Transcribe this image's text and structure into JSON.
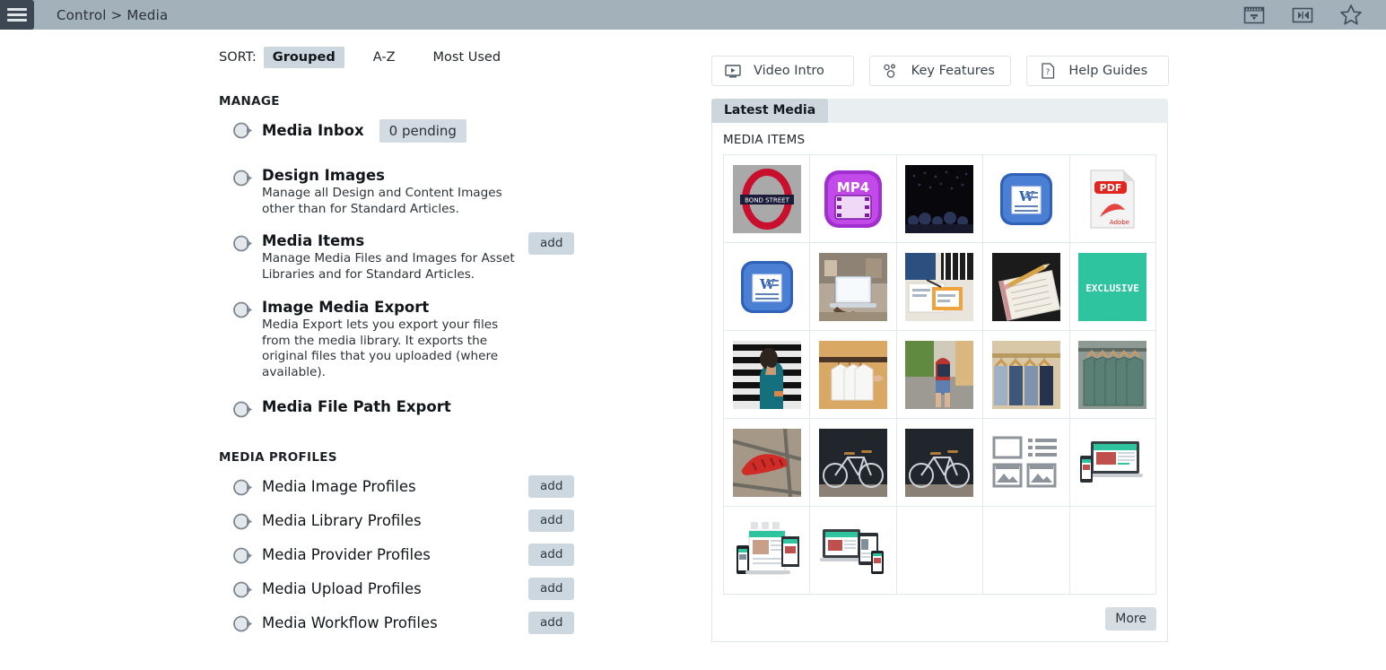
{
  "topbar": {
    "menu_icon": "hamburger-menu-icon",
    "breadcrumb": "Control > Media",
    "icons": [
      {
        "name": "media-panel-icon",
        "label": "panel"
      },
      {
        "name": "navigation-arrows-icon",
        "label": "nav"
      },
      {
        "name": "favourite-star-icon",
        "label": "star"
      }
    ]
  },
  "sort": {
    "label": "SORT:",
    "options": [
      {
        "label": "Grouped",
        "active": true
      },
      {
        "label": "A-Z",
        "active": false
      },
      {
        "label": "Most Used",
        "active": false
      }
    ]
  },
  "manage": {
    "heading": "MANAGE",
    "items": [
      {
        "title": "Media Inbox",
        "desc": "",
        "pill": "0 pending",
        "add": ""
      },
      {
        "title": "Design Images",
        "desc": "Manage all Design and Content Images other than for Standard Articles.",
        "pill": "",
        "add": ""
      },
      {
        "title": "Media Items",
        "desc": "Manage Media Files and Images for Asset Libraries and for Standard Articles.",
        "pill": "",
        "add": "add"
      },
      {
        "title": "Image Media Export",
        "desc": "Media Export lets you export your files from the media library. It exports the original files that you uploaded (where available).",
        "pill": "",
        "add": ""
      },
      {
        "title": "Media File Path Export",
        "desc": "",
        "pill": "",
        "add": ""
      }
    ]
  },
  "profiles": {
    "heading": "MEDIA PROFILES",
    "items": [
      {
        "title": "Media Image Profiles",
        "add": "add"
      },
      {
        "title": "Media Library Profiles",
        "add": "add"
      },
      {
        "title": "Media Provider Profiles",
        "add": "add"
      },
      {
        "title": "Media Upload Profiles",
        "add": "add"
      },
      {
        "title": "Media Workflow Profiles",
        "add": "add"
      }
    ]
  },
  "actions": [
    {
      "label": "Video Intro",
      "icon": "video-play-icon"
    },
    {
      "label": "Key Features",
      "icon": "key-features-icon"
    },
    {
      "label": "Help Guides",
      "icon": "help-document-icon"
    }
  ],
  "panel": {
    "tab": "Latest Media",
    "caption": "MEDIA ITEMS",
    "more": "More",
    "media_items": [
      {
        "kind": "image",
        "name": "bond-street-roundel-thumb"
      },
      {
        "kind": "icon",
        "name": "mp4-file-icon",
        "label": "MP4"
      },
      {
        "kind": "image",
        "name": "concert-crowd-thumb"
      },
      {
        "kind": "icon",
        "name": "word-document-icon",
        "label": "W"
      },
      {
        "kind": "icon",
        "name": "pdf-file-icon",
        "label": "PDF"
      },
      {
        "kind": "icon",
        "name": "word-document-icon",
        "label": "W"
      },
      {
        "kind": "image",
        "name": "laptop-desk-thumb"
      },
      {
        "kind": "image",
        "name": "meeting-papers-thumb"
      },
      {
        "kind": "image",
        "name": "pencil-notebook-thumb"
      },
      {
        "kind": "icon",
        "name": "exclusive-banner-thumb",
        "label": "EXCLUSIVE"
      },
      {
        "kind": "image",
        "name": "woman-blinds-thumb"
      },
      {
        "kind": "image",
        "name": "white-shirts-hanger-thumb"
      },
      {
        "kind": "image",
        "name": "street-backpack-thumb"
      },
      {
        "kind": "image",
        "name": "denim-rail-thumb"
      },
      {
        "kind": "image",
        "name": "green-tshirts-rail-thumb"
      },
      {
        "kind": "image",
        "name": "red-bike-helmet-thumb"
      },
      {
        "kind": "image",
        "name": "bicycle-dark-wall-thumb"
      },
      {
        "kind": "image",
        "name": "bicycle-dark-wall-thumb"
      },
      {
        "kind": "icon",
        "name": "gallery-placeholder-icon"
      },
      {
        "kind": "image",
        "name": "responsive-devices-laptop-thumb"
      },
      {
        "kind": "image",
        "name": "responsive-print-devices-thumb"
      },
      {
        "kind": "image",
        "name": "responsive-devices-tablet-thumb"
      },
      {
        "kind": "empty",
        "name": "empty-cell"
      },
      {
        "kind": "empty",
        "name": "empty-cell"
      },
      {
        "kind": "empty",
        "name": "empty-cell"
      }
    ]
  },
  "colors": {
    "topbar": "#a3b2ba",
    "menu_button": "#3c4753",
    "active_sort": "#ccd6de",
    "tab_active": "#ccd6dc",
    "panel_header": "#e9eef0",
    "add_button": "#ccd7e0",
    "exclusive_teal": "#2ec4a0"
  }
}
